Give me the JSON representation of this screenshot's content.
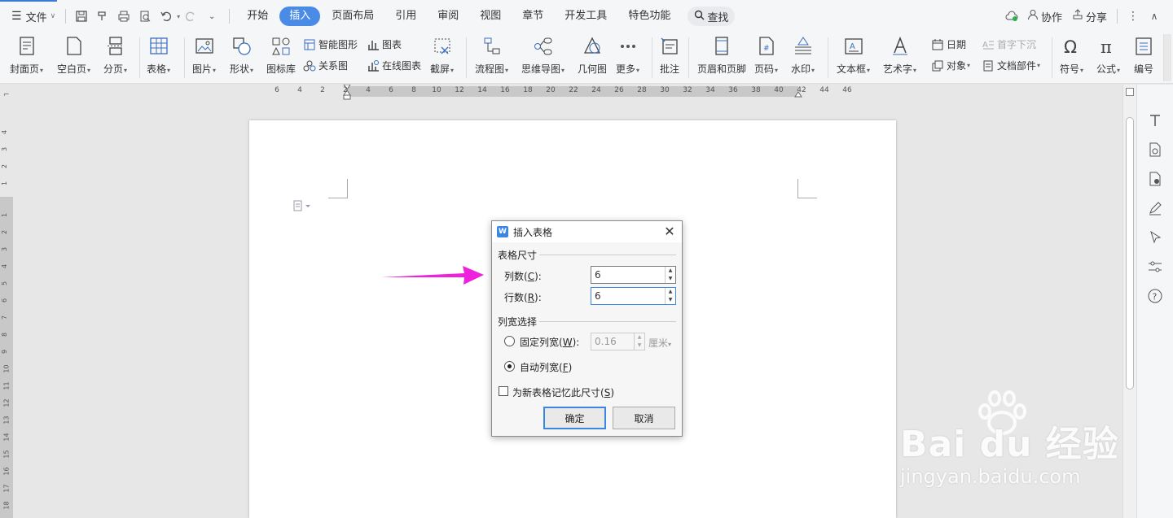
{
  "menubar": {
    "file_label": "文件",
    "tabs": [
      "开始",
      "插入",
      "页面布局",
      "引用",
      "审阅",
      "视图",
      "章节",
      "开发工具",
      "特色功能"
    ],
    "active_tab": "插入",
    "search_label": "查找",
    "collab_label": "协作",
    "share_label": "分享"
  },
  "ribbon": {
    "cover_page": "封面页",
    "blank_page": "空白页",
    "page_break": "分页",
    "table": "表格",
    "picture": "图片",
    "shape": "形状",
    "icon_lib": "图标库",
    "smart_art": "智能图形",
    "chart": "图表",
    "relation": "关系图",
    "online_chart": "在线图表",
    "screenshot": "截屏",
    "flowchart": "流程图",
    "mindmap": "思维导图",
    "geometry": "几何图",
    "more": "更多",
    "comment": "批注",
    "header_footer": "页眉和页脚",
    "page_number": "页码",
    "watermark": "水印",
    "textbox": "文本框",
    "wordart": "艺术字",
    "date": "日期",
    "object": "对象",
    "dropcap": "首字下沉",
    "doc_parts": "文档部件",
    "symbol": "符号",
    "formula": "公式",
    "numbering": "编号"
  },
  "ruler": {
    "h_marks": [
      "6",
      "4",
      "2",
      "2",
      "4",
      "6",
      "8",
      "10",
      "12",
      "14",
      "16",
      "18",
      "20",
      "22",
      "24",
      "26",
      "28",
      "30",
      "32",
      "34",
      "36",
      "38",
      "40",
      "42",
      "44",
      "46"
    ],
    "v_marks": [
      "4",
      "3",
      "2",
      "1",
      "1",
      "2",
      "3",
      "4",
      "5",
      "6",
      "7",
      "8",
      "9",
      "10",
      "11",
      "12",
      "13",
      "14",
      "15",
      "16",
      "17",
      "18"
    ]
  },
  "dialog": {
    "title": "插入表格",
    "size_group": "表格尺寸",
    "cols_label": "列数(",
    "cols_key": "C",
    "cols_suffix": "):",
    "cols_value": "6",
    "rows_label": "行数(",
    "rows_key": "R",
    "rows_suffix": "):",
    "rows_value": "6",
    "width_group": "列宽选择",
    "fixed_label": "固定列宽(",
    "fixed_key": "W",
    "fixed_suffix": "):",
    "fixed_value": "0.16",
    "fixed_unit": "厘米",
    "auto_label": "自动列宽(",
    "auto_key": "F",
    "auto_suffix": ")",
    "remember_label": "为新表格记忆此尺寸(",
    "remember_key": "S",
    "remember_suffix": ")",
    "ok": "确定",
    "cancel": "取消"
  },
  "watermark": {
    "main": "Bai du 经验",
    "sub": "jingyan.baidu.com"
  },
  "colors": {
    "accent": "#4a8be6",
    "arrow": "#ee22dd"
  }
}
